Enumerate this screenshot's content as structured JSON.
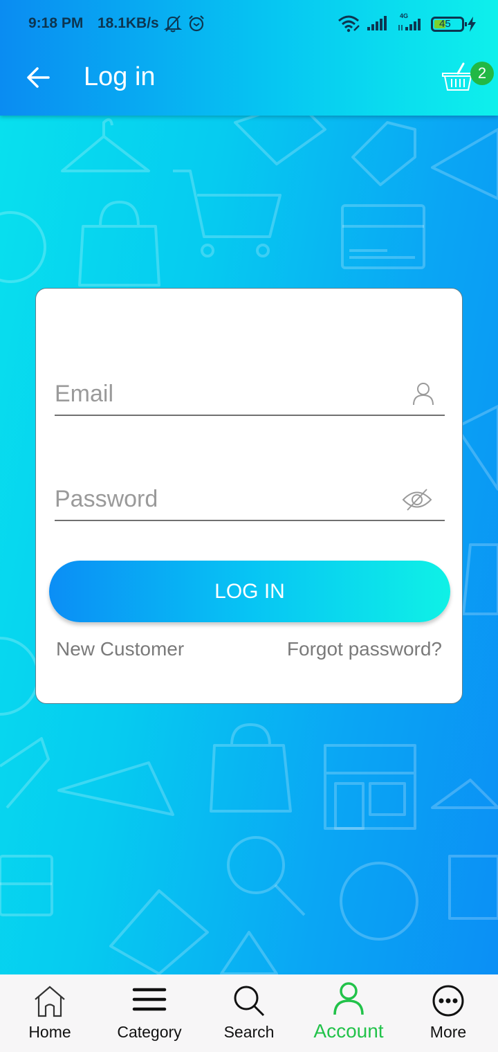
{
  "status_bar": {
    "time": "9:18 PM",
    "network_speed": "18.1KB/s",
    "icons": [
      "bell-muted-icon",
      "alarm-icon",
      "wifi-icon",
      "signal-icon",
      "signal-4g-icon",
      "battery-icon",
      "charging-icon"
    ],
    "network_type": "4G",
    "battery_level": "45"
  },
  "app_bar": {
    "title": "Log in",
    "back_icon": "arrow-left-icon",
    "cart_icon": "basket-icon",
    "cart_count": "2"
  },
  "login_form": {
    "email": {
      "placeholder": "Email",
      "value": "",
      "icon": "user-icon"
    },
    "password": {
      "placeholder": "Password",
      "value": "",
      "icon": "eye-off-icon"
    },
    "login_button": "LOG IN",
    "new_customer_link": "New Customer",
    "forgot_password_link": "Forgot password?"
  },
  "bottom_nav": {
    "items": [
      {
        "label": "Home",
        "icon": "home-icon",
        "active": false
      },
      {
        "label": "Category",
        "icon": "menu-icon",
        "active": false
      },
      {
        "label": "Search",
        "icon": "search-icon",
        "active": false
      },
      {
        "label": "Account",
        "icon": "user-icon",
        "active": true
      },
      {
        "label": "More",
        "icon": "more-icon",
        "active": false
      }
    ]
  },
  "colors": {
    "accent_active": "#22c24a",
    "badge": "#22b845",
    "gradient_start": "#0b8ef5",
    "gradient_end": "#0ff1e6"
  }
}
